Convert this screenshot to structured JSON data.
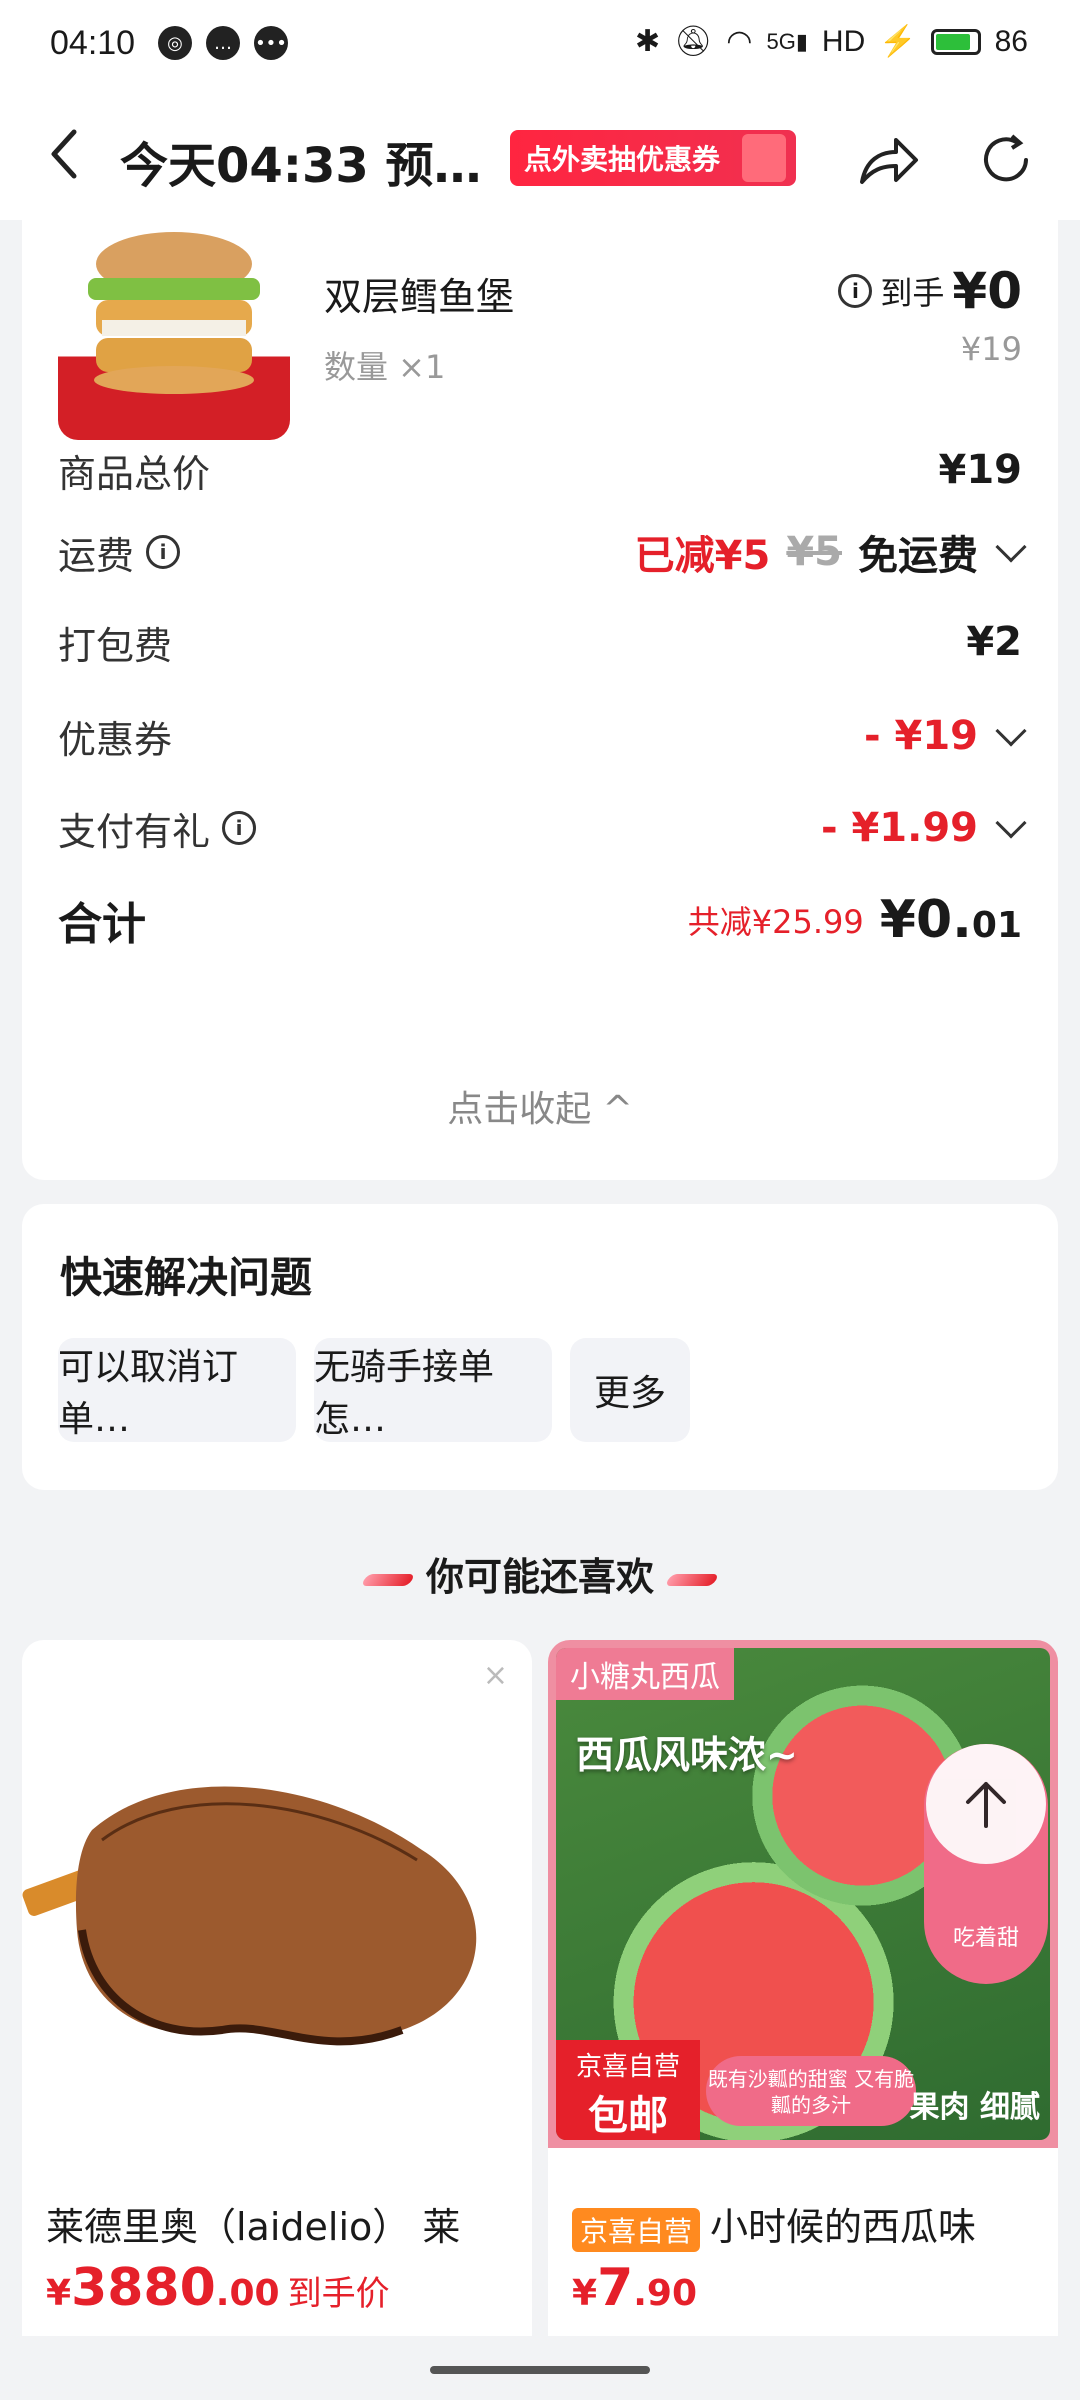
{
  "status_bar": {
    "time": "04:10",
    "network": "5G",
    "hd": "HD",
    "battery": "86",
    "battery_level": 0.86
  },
  "header": {
    "title": "今天04:33 预…",
    "promo": "点外卖抽优惠券"
  },
  "product": {
    "name": "双层鳕鱼堡",
    "quantity": "数量 ×1",
    "final_label": "到手",
    "final_price": "¥0",
    "original_price": "¥19"
  },
  "fees": {
    "subtotal_label": "商品总价",
    "subtotal_value": "¥19",
    "delivery_label": "运费",
    "delivery_saved": "已减¥5",
    "delivery_orig": "¥5",
    "delivery_value": "免运费",
    "packing_label": "打包费",
    "packing_value": "¥2",
    "coupon_label": "优惠券",
    "coupon_value": "- ¥19",
    "gift_label": "支付有礼",
    "gift_value": "- ¥1.99",
    "total_label": "合计",
    "total_saved": "共减¥25.99",
    "total_main": "¥0.",
    "total_cents": "01",
    "collapse": "点击收起 ^"
  },
  "quick": {
    "title": "快速解决问题",
    "chips": [
      "可以取消订单…",
      "无骑手接单怎…",
      "更多"
    ]
  },
  "recommend": {
    "heading": "你可能还喜欢",
    "items": [
      {
        "name": "莱德里奥（laidelio） 莱",
        "price_symbol": "¥",
        "price_int": "3880",
        "price_dec": ".00",
        "price_tag": "到手价"
      },
      {
        "badge": "京喜自营",
        "name": "小时候的西瓜味",
        "price_symbol": "¥",
        "price_int": "7",
        "price_dec": ".90",
        "img_tag": "小糖丸西瓜",
        "img_slogan": "西瓜风味浓~",
        "ship_top": "京喜自营",
        "ship_bottom": "包邮",
        "bubble": "既有沙瓤的甜蜜 又有脆瓤的多汁",
        "fruit": "果肉 细腻"
      }
    ]
  },
  "float_button": {
    "label": "吃着甜"
  }
}
